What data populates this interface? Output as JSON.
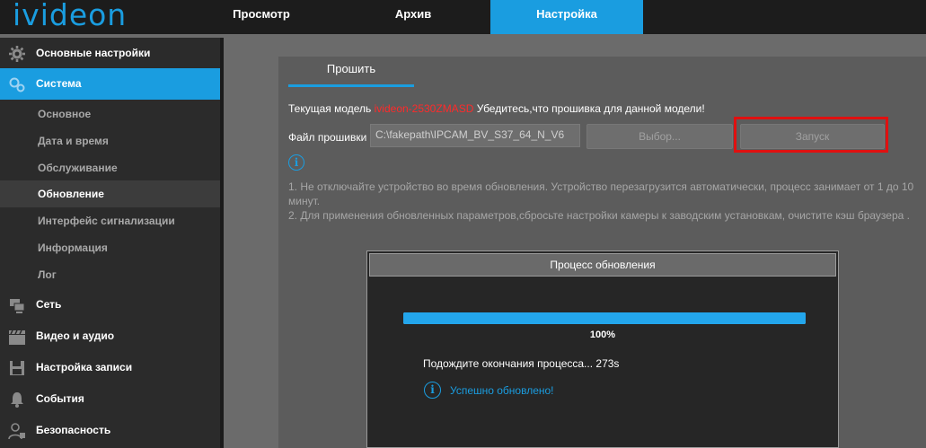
{
  "brand": {
    "logo": "ivideon",
    "accent": "#1a9de0",
    "warning": "#ff2a2a"
  },
  "topnav": {
    "tabs": [
      {
        "label": "Просмотр"
      },
      {
        "label": "Архив"
      },
      {
        "label": "Настройка",
        "active": true
      }
    ]
  },
  "sidebar": {
    "items": [
      {
        "label": "Основные настройки",
        "icon": "gear-icon"
      },
      {
        "label": "Система",
        "icon": "gears-icon",
        "active": true
      },
      {
        "label": "Сеть",
        "icon": "network-icon"
      },
      {
        "label": "Видео и аудио",
        "icon": "clapperboard-icon"
      },
      {
        "label": "Настройка записи",
        "icon": "floppy-disk-icon"
      },
      {
        "label": "События",
        "icon": "bell-icon"
      },
      {
        "label": "Безопасность",
        "icon": "user-lock-icon"
      }
    ],
    "subitems": [
      {
        "label": "Основное"
      },
      {
        "label": "Дата и время"
      },
      {
        "label": "Обслуживание"
      },
      {
        "label": "Обновление",
        "current": true
      },
      {
        "label": "Интерфейс сигнализации"
      },
      {
        "label": "Информация"
      },
      {
        "label": "Лог"
      }
    ]
  },
  "panel": {
    "tab_label": "Прошить",
    "model_prefix": "Текущая модель",
    "model_name": "ivideon-2530ZMASD",
    "model_suffix": "Убедитесь,что прошивка для данной модели!",
    "file_label": "Файл прошивки",
    "file_value": "C:\\fakepath\\IPCAM_BV_S37_64_N_V6",
    "browse_label": "Выбор...",
    "launch_label": "Запуск",
    "info_glyph": "i",
    "note1": "1. Не отключайте устройство во время обновления. Устройство перезагрузится автоматически, процесс занимает от 1 до 10 минут.",
    "note2": "2. Для применения обновленных параметров,сбросьте настройки камеры к заводским установкам, очистите кэш браузера ."
  },
  "dialog": {
    "title": "Процесс обновления",
    "progress": 100,
    "progress_label": "100%",
    "wait_text": "Подождите окончания процесса... 273s",
    "success_glyph": "i",
    "success_text": "Успешно обновлено!"
  }
}
